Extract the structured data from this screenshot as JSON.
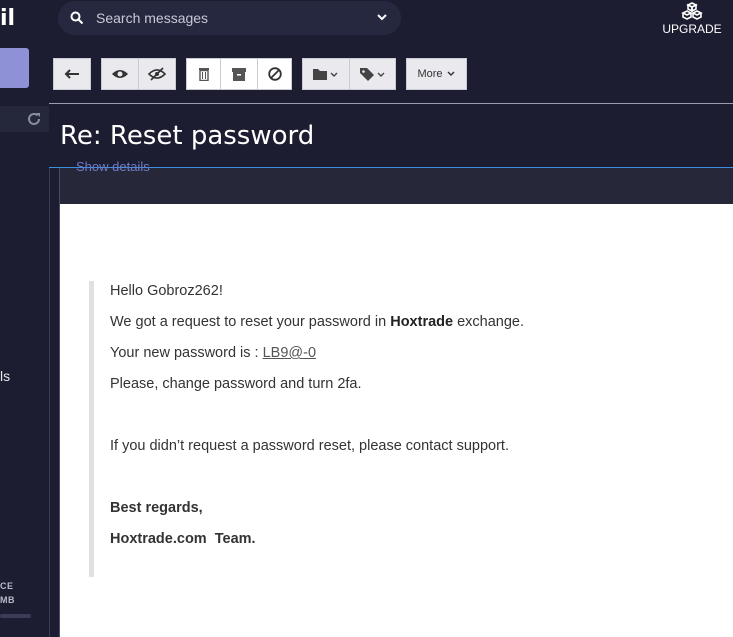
{
  "topbar": {
    "logo_fragment": "il",
    "search_placeholder": "Search messages",
    "upgrade_label": "UPGRADE"
  },
  "sidebar": {
    "label_fragment": "ls",
    "storage_line1": "CE",
    "storage_line2": "MB"
  },
  "toolbar": {
    "more_label": "More"
  },
  "message": {
    "subject": "Re: Reset password",
    "show_details": "Show details",
    "greeting": "Hello Gobroz262!",
    "line1_pre": "We got a request to reset your password in ",
    "line1_brand": "Hoxtrade",
    "line1_post": " exchange.",
    "line2_pre": "Your new password is : ",
    "line2_password": "LB9@-0",
    "line3": "Please, change password and turn 2fa.",
    "line4": "If you didn’t request a password reset, please contact support.",
    "sign1": "Best regards,",
    "sign2": "Hoxtrade.com  Team."
  }
}
